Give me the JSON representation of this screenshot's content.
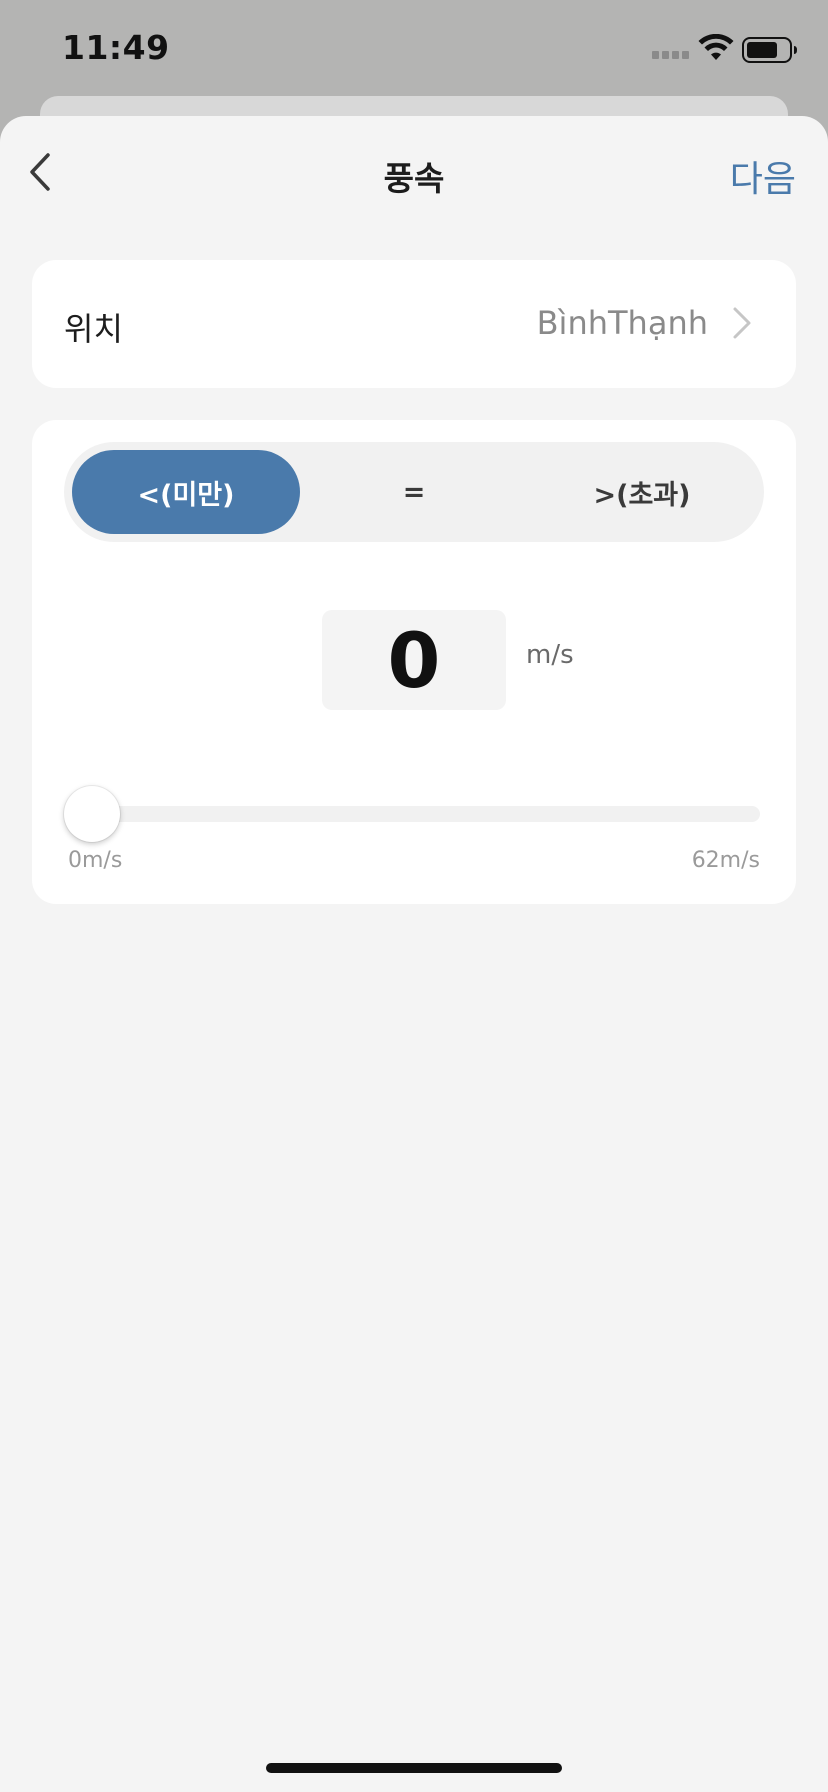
{
  "status_bar": {
    "time": "11:49"
  },
  "nav": {
    "back_icon": "chevron-left-icon",
    "title": "풍속",
    "next_label": "다음"
  },
  "location": {
    "label": "위치",
    "value": "BìnhThạnh",
    "chevron_icon": "chevron-right-icon"
  },
  "condition": {
    "operators": [
      {
        "label": "<(미만)",
        "selected": true
      },
      {
        "label": "=",
        "selected": false
      },
      {
        "label": ">(초과)",
        "selected": false
      }
    ],
    "value": "0",
    "unit": "m/s",
    "slider": {
      "min_label": "0m/s",
      "max_label": "62m/s",
      "min": 0,
      "max": 62,
      "current": 0
    }
  },
  "colors": {
    "accent": "#4a7aab",
    "sheet_background": "#f4f4f4",
    "card_background": "#ffffff"
  }
}
